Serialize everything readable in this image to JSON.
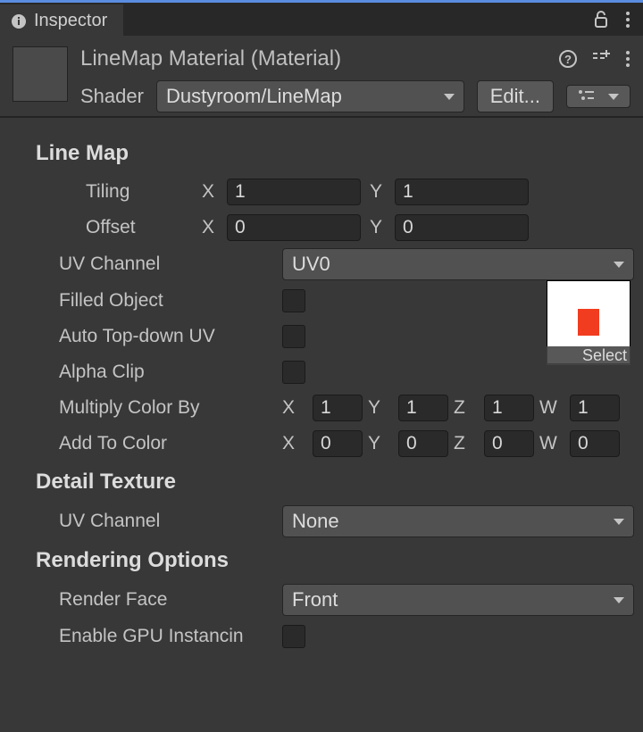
{
  "tab": {
    "label": "Inspector"
  },
  "header": {
    "title": "LineMap Material (Material)",
    "shader_label": "Shader",
    "shader_value": "Dustyroom/LineMap",
    "edit_button": "Edit..."
  },
  "texture_slot": {
    "select_label": "Select"
  },
  "sections": {
    "linemap": {
      "title": "Line Map",
      "tiling": {
        "label": "Tiling",
        "x_label": "X",
        "x": "1",
        "y_label": "Y",
        "y": "1"
      },
      "offset": {
        "label": "Offset",
        "x_label": "X",
        "x": "0",
        "y_label": "Y",
        "y": "0"
      },
      "uv_channel": {
        "label": "UV Channel",
        "value": "UV0"
      },
      "filled_object": {
        "label": "Filled Object",
        "checked": false
      },
      "auto_topdown": {
        "label": "Auto Top-down UV",
        "checked": false
      },
      "alpha_clip": {
        "label": "Alpha Clip",
        "checked": false
      },
      "multiply_color": {
        "label": "Multiply Color By",
        "x": "1",
        "y": "1",
        "z": "1",
        "w": "1"
      },
      "add_to_color": {
        "label": "Add To Color",
        "x": "0",
        "y": "0",
        "z": "0",
        "w": "0"
      },
      "axis": {
        "x": "X",
        "y": "Y",
        "z": "Z",
        "w": "W"
      }
    },
    "detail": {
      "title": "Detail Texture",
      "uv_channel": {
        "label": "UV Channel",
        "value": "None"
      }
    },
    "rendering": {
      "title": "Rendering Options",
      "render_face": {
        "label": "Render Face",
        "value": "Front"
      },
      "gpu_instancing": {
        "label": "Enable GPU Instancin",
        "checked": false
      }
    }
  }
}
